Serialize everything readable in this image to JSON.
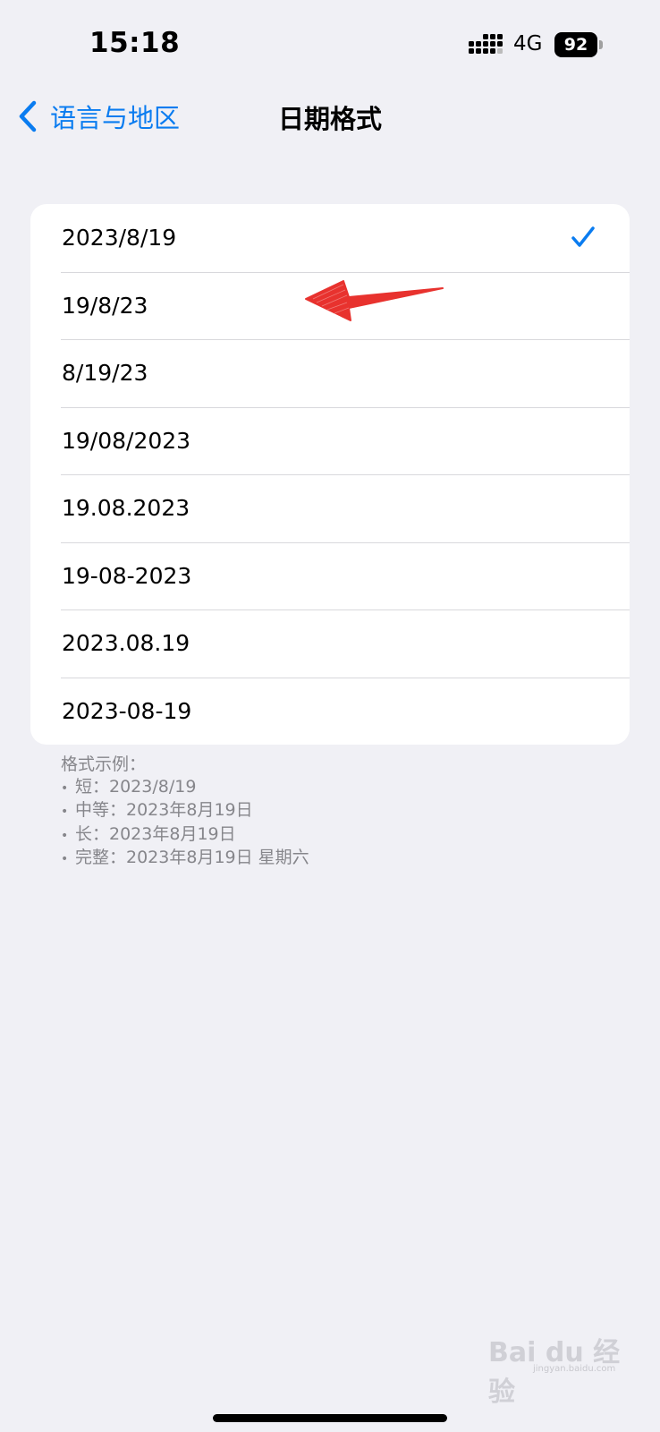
{
  "status_bar": {
    "time": "15:18",
    "network": "4G",
    "battery": "92",
    "signal_icon": "signal-bars-icon"
  },
  "nav": {
    "back_label": "语言与地区",
    "title": "日期格式",
    "back_icon": "chevron-left-icon"
  },
  "date_formats": {
    "selected_index": 0,
    "items": [
      {
        "label": "2023/8/19"
      },
      {
        "label": "19/8/23"
      },
      {
        "label": "8/19/23"
      },
      {
        "label": "19/08/2023"
      },
      {
        "label": "19.08.2023"
      },
      {
        "label": "19-08-2023"
      },
      {
        "label": "2023.08.19"
      },
      {
        "label": "2023-08-19"
      }
    ],
    "check_icon": "checkmark-icon",
    "accent_color": "#0a7cf0"
  },
  "examples": {
    "heading": "格式示例：",
    "lines": [
      "短：2023/8/19",
      "中等：2023年8月19日",
      "长：2023年8月19日",
      "完整：2023年8月19日 星期六"
    ]
  },
  "annotation": {
    "arrow_icon": "red-arrow-icon",
    "color": "#e8322e"
  },
  "watermark": {
    "text": "Bai du 经验",
    "sub": "jingyan.baidu.com"
  }
}
